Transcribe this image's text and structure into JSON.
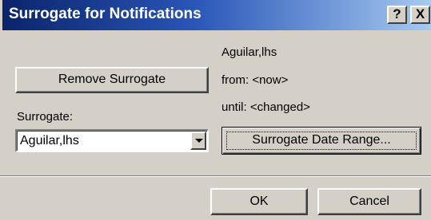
{
  "dialog": {
    "title": "Surrogate for Notifications",
    "help_label": "?",
    "close_label": "X"
  },
  "surrogate_info": {
    "name": "Aguilar,lhs",
    "from": "from: <now>",
    "until": "until: <changed>"
  },
  "buttons": {
    "remove_surrogate": "Remove Surrogate",
    "surrogate_date_range": "Surrogate Date Range...",
    "ok": "OK",
    "cancel": "Cancel"
  },
  "surrogate_field": {
    "label": "Surrogate:",
    "value": "Aguilar,lhs"
  }
}
